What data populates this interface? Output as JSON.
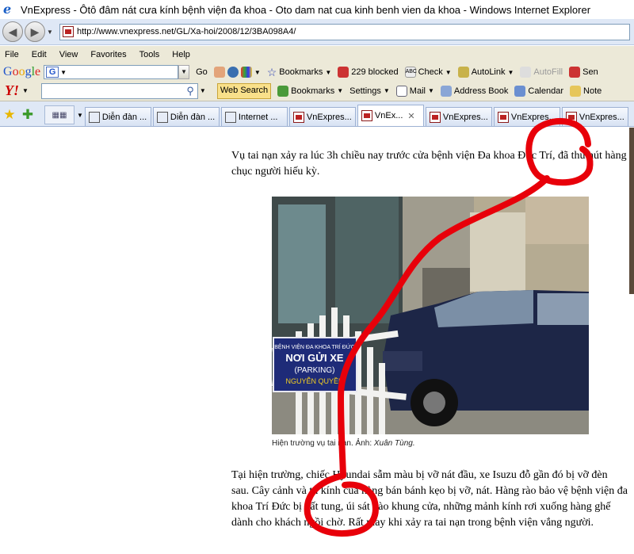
{
  "window": {
    "title": "VnExpress - Ôtô đâm nát cưa kính bệnh viện đa khoa - Oto dam nat cua kinh benh vien da khoa - Windows Internet Explorer"
  },
  "address": {
    "url": "http://www.vnexpress.net/GL/Xa-hoi/2008/12/3BA098A4/"
  },
  "menu": [
    "File",
    "Edit",
    "View",
    "Favorites",
    "Tools",
    "Help"
  ],
  "google_toolbar": {
    "go": "Go",
    "bookmarks": "Bookmarks",
    "blocked": "229 blocked",
    "check": "Check",
    "autolink": "AutoLink",
    "autofill": "AutoFill",
    "send": "Sen"
  },
  "yahoo_toolbar": {
    "logo": "Y!",
    "web_search": "Web Search",
    "bookmarks": "Bookmarks",
    "settings": "Settings",
    "mail": "Mail",
    "address_book": "Address Book",
    "calendar": "Calendar",
    "notepad": "Note"
  },
  "tabs": [
    {
      "label": "Diễn đàn ...",
      "icon": "ie-page-icon",
      "active": false
    },
    {
      "label": "Diễn đàn ...",
      "icon": "ie-page-icon",
      "active": false
    },
    {
      "label": "Internet ...",
      "icon": "ie-page-icon",
      "active": false
    },
    {
      "label": "VnExpres...",
      "icon": "vnexpress-icon",
      "active": false
    },
    {
      "label": "VnEx...",
      "icon": "vnexpress-icon",
      "active": true
    },
    {
      "label": "VnExpres...",
      "icon": "vnexpress-icon",
      "active": false
    },
    {
      "label": "VnExpres...",
      "icon": "vnexpress-icon",
      "active": false
    },
    {
      "label": "VnExpres...",
      "icon": "vnexpress-icon",
      "active": false
    }
  ],
  "article": {
    "para1": "Vụ tai nạn xảy ra lúc 3h chiều nay trước cửa bệnh viện Đa khoa Đức Trí, đã thu hút hàng chục người hiếu kỳ.",
    "caption_text": "Hiện trường vụ tai nạn. Ảnh: ",
    "caption_author": "Xuân Tùng.",
    "para2": "Tại hiện trường, chiếc Hyundai sẫm màu bị vỡ nát đầu, xe Isuzu đỗ gần đó bị vỡ đèn sau. Cây cảnh và tủ kính của hàng bán bánh kẹo bị vỡ, nát. Hàng rào bảo vệ bệnh viện đa khoa Trí Đức bị hất tung, úi sát vào khung cửa, những mảnh kính rơi xuống hàng ghế dành cho khách ngồi chờ. Rất may khi xảy ra tai nạn trong bệnh viện vắng người.",
    "sign_line1": "BỆNH VIỆN ĐA KHOA TRÍ ĐỨC",
    "sign_line2": "NƠI GỬI XE",
    "sign_line3": "(PARKING)",
    "sign_line4": "NGUYỄN QUYỀN"
  },
  "colors": {
    "annotation": "#e8000a",
    "chrome": "#dfe8f6",
    "toolbar": "#ece9d8"
  }
}
